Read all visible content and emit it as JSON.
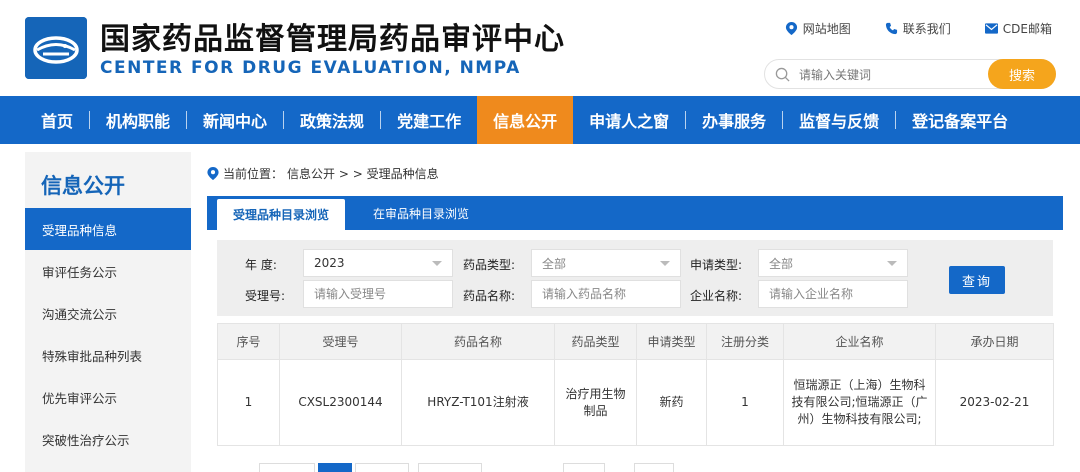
{
  "header": {
    "title_cn": "国家药品监督管理局药品审评中心",
    "title_en": "CENTER FOR DRUG EVALUATION, NMPA",
    "links": [
      {
        "label": "网站地图",
        "icon": "map-pin-icon"
      },
      {
        "label": "联系我们",
        "icon": "phone-icon"
      },
      {
        "label": "CDE邮箱",
        "icon": "mail-icon"
      }
    ],
    "search": {
      "placeholder": "请输入关键词",
      "button": "搜索"
    }
  },
  "nav": {
    "items": [
      "首页",
      "机构职能",
      "新闻中心",
      "政策法规",
      "党建工作",
      "信息公开",
      "申请人之窗",
      "办事服务",
      "监督与反馈",
      "登记备案平台"
    ],
    "active": "信息公开"
  },
  "sidebar": {
    "title": "信息公开",
    "items": [
      "受理品种信息",
      "审评任务公示",
      "沟通交流公示",
      "特殊审批品种列表",
      "优先审评公示",
      "突破性治疗公示"
    ]
  },
  "breadcrumb": {
    "prefix": "当前位置：",
    "path": "信息公开 > > 受理品种信息"
  },
  "tabs": [
    "受理品种目录浏览",
    "在审品种目录浏览"
  ],
  "filters": {
    "year_label": "年  度:",
    "year_value": "2023",
    "drug_type_label": "药品类型:",
    "drug_type_value": "全部",
    "apply_type_label": "申请类型:",
    "apply_type_value": "全部",
    "accept_no_label": "受理号:",
    "accept_no_placeholder": "请输入受理号",
    "drug_name_label": "药品名称:",
    "drug_name_placeholder": "请输入药品名称",
    "company_label": "企业名称:",
    "company_placeholder": "请输入企业名称",
    "query_button": "查询"
  },
  "table": {
    "headers": [
      "序号",
      "受理号",
      "药品名称",
      "药品类型",
      "申请类型",
      "注册分类",
      "企业名称",
      "承办日期"
    ],
    "rows": [
      [
        "1",
        "CXSL2300144",
        "HRYZ-T101注射液",
        "治疗用生物制品",
        "新药",
        "1",
        "恒瑞源正（上海）生物科技有限公司;恒瑞源正（广州）生物科技有限公司;",
        "2023-02-21"
      ]
    ]
  },
  "colors": {
    "primary": "#1468c8",
    "accent": "#ef8a1d",
    "search_button": "#f5a51c"
  }
}
